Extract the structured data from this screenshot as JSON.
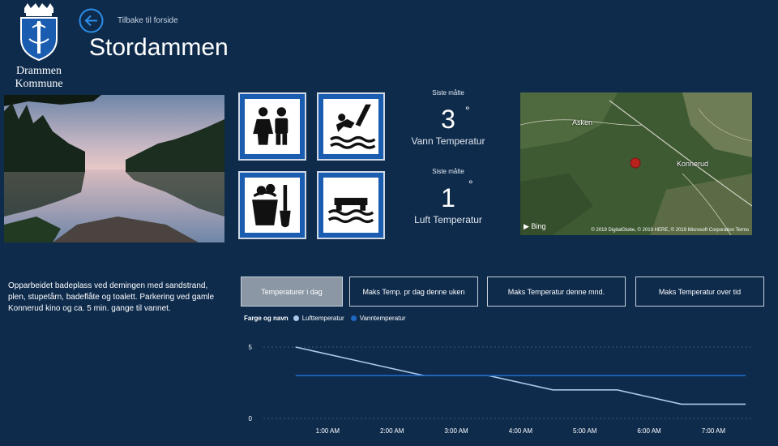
{
  "header": {
    "org_name_line1": "Drammen",
    "org_name_line2": "Kommune",
    "back_label": "Tilbake til forside",
    "title": "Stordammen"
  },
  "facilities": [
    {
      "name": "toilets",
      "icon": "toilet-icon"
    },
    {
      "name": "diving",
      "icon": "diving-tower-icon"
    },
    {
      "name": "sand-beach",
      "icon": "sand-bucket-icon"
    },
    {
      "name": "bathing-float",
      "icon": "bathing-float-icon"
    }
  ],
  "water_temp": {
    "caption": "Siste målte",
    "value": "3",
    "degree": "°",
    "label": "Vann Temperatur"
  },
  "air_temp": {
    "caption": "Siste målte",
    "value": "1",
    "degree": "°",
    "label": "Luft Temperatur"
  },
  "map": {
    "labels": {
      "asken": "Asken",
      "konnerud": "Konnerud"
    },
    "bing": "Bing",
    "copyright": "© 2019 DigitalGlobe, © 2019 HERE, © 2019 Microsoft Corporation Terms"
  },
  "description": "Opparbeidet badeplass ved demingen med sandstrand, plen, stupetårn, badeflåte og toalett. Parkering ved gamle Konnerud kino og ca. 5 min. gange til vannet.",
  "tabs": [
    {
      "label": "Temperaturer i dag",
      "active": true
    },
    {
      "label": "Maks Temp. pr dag denne uken",
      "active": false
    },
    {
      "label": "Maks Temperatur denne mnd.",
      "active": false
    },
    {
      "label": "Maks Temperatur over tid",
      "active": false
    }
  ],
  "legend": {
    "title": "Farge og navn",
    "items": [
      "Lufttemperatur",
      "Vanntemperatur"
    ]
  },
  "colors": {
    "background": "#0e2b4c",
    "accent": "#1a5db0",
    "air_series": "#a9c8ea",
    "water_series": "#2167c4"
  },
  "chart_data": {
    "type": "line",
    "x": [
      "1:00 AM",
      "2:00 AM",
      "3:00 AM",
      "4:00 AM",
      "5:00 AM",
      "6:00 AM",
      "7:00 AM"
    ],
    "ylim": [
      0,
      5
    ],
    "yticks": [
      "0",
      "5"
    ],
    "series": [
      {
        "name": "Lufttemperatur",
        "color": "#a9c8ea",
        "points": [
          [
            0.5,
            5
          ],
          [
            1.5,
            4
          ],
          [
            2.5,
            3
          ],
          [
            3.5,
            3
          ],
          [
            4.5,
            2
          ],
          [
            5.5,
            2
          ],
          [
            6.5,
            1
          ],
          [
            7.5,
            1
          ]
        ]
      },
      {
        "name": "Vanntemperatur",
        "color": "#2167c4",
        "points": [
          [
            0.5,
            3
          ],
          [
            7.5,
            3
          ]
        ]
      }
    ],
    "grid": true,
    "legend_position": "top-left"
  }
}
